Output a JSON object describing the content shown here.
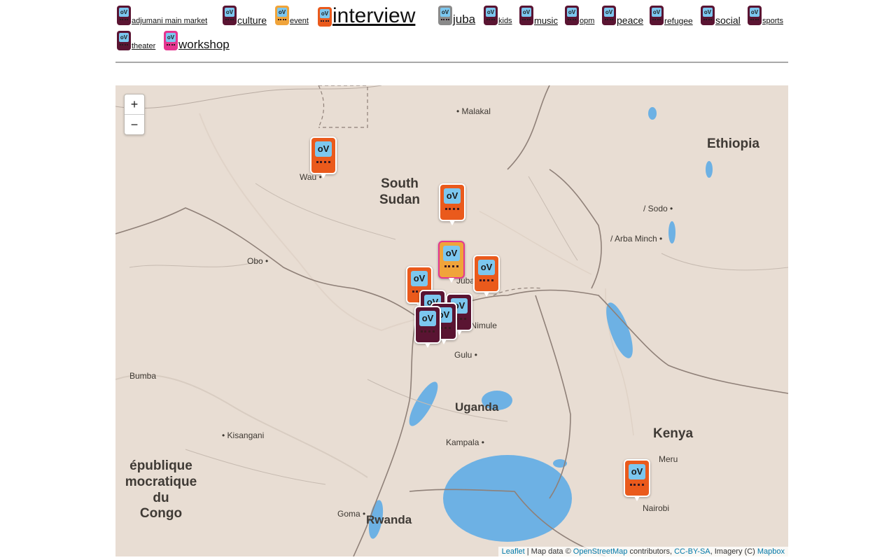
{
  "tags": [
    {
      "label": "adjumani main market",
      "color": "#5a1432"
    },
    {
      "label": "culture",
      "color": "#5a1432"
    },
    {
      "label": "event",
      "color": "#f0a43a"
    },
    {
      "label": "interview",
      "color": "#ea5a1c"
    },
    {
      "label": "juba",
      "color": "#8a8a8a"
    },
    {
      "label": "kids",
      "color": "#5a1432"
    },
    {
      "label": "music",
      "color": "#5a1432"
    },
    {
      "label": "opm",
      "color": "#5a1432"
    },
    {
      "label": "peace",
      "color": "#5a1432"
    },
    {
      "label": "refugee",
      "color": "#5a1432"
    },
    {
      "label": "social",
      "color": "#5a1432"
    },
    {
      "label": "sports",
      "color": "#5a1432"
    },
    {
      "label": "theater",
      "color": "#5a1432"
    },
    {
      "label": "workshop",
      "color": "#e53690"
    }
  ],
  "icon_text": "oV",
  "map": {
    "zoom_in": "+",
    "zoom_out": "−",
    "cities": [
      "Malakal",
      "Wau",
      "Obo",
      "Juba",
      "Nimule",
      "Gulu",
      "Bumba",
      "Kisangani",
      "Kampala",
      "Goma",
      "Nairobi",
      "Meru",
      "Sodo",
      "Arba Minch"
    ],
    "countries": {
      "south_sudan": "South Sudan",
      "ethiopia": "Ethiopia",
      "uganda": "Uganda",
      "kenya": "Kenya",
      "rwanda": "Rwanda",
      "drc": "épublique\nmocratique\ndu\nCongo"
    },
    "marker_colors": {
      "interview": "#ea5a1c",
      "event": "#f0a43a",
      "culture": "#5a1432",
      "workshop": "#e53690"
    },
    "attribution": {
      "leaflet": "Leaflet",
      "sep": " | Map data © ",
      "osm": "OpenStreetMap",
      "contrib": " contributors, ",
      "license": "CC-BY-SA",
      "imagery": ", Imagery (C) ",
      "mapbox": "Mapbox"
    }
  }
}
